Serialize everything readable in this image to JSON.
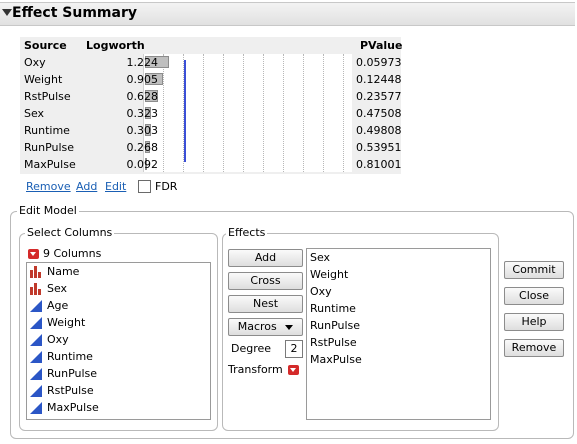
{
  "outline": {
    "title": "Effect Summary"
  },
  "table": {
    "headers": {
      "source": "Source",
      "logworth": "Logworth",
      "pvalue": "PValue"
    },
    "rows": [
      {
        "source": "Oxy",
        "logworth": "1.224",
        "pvalue": "0.05973",
        "value": 1.224
      },
      {
        "source": "Weight",
        "logworth": "0.905",
        "pvalue": "0.12448",
        "value": 0.905
      },
      {
        "source": "RstPulse",
        "logworth": "0.628",
        "pvalue": "0.23577",
        "value": 0.628
      },
      {
        "source": "Sex",
        "logworth": "0.323",
        "pvalue": "0.47508",
        "value": 0.323
      },
      {
        "source": "Runtime",
        "logworth": "0.303",
        "pvalue": "0.49808",
        "value": 0.303
      },
      {
        "source": "RunPulse",
        "logworth": "0.268",
        "pvalue": "0.53951",
        "value": 0.268
      },
      {
        "source": "MaxPulse",
        "logworth": "0.092",
        "pvalue": "0.81001",
        "value": 0.092
      }
    ],
    "reference_logworth": 2.0
  },
  "actions": {
    "remove": "Remove",
    "add": "Add",
    "edit": "Edit",
    "fdr": "FDR",
    "fdr_checked": false
  },
  "edit_model": {
    "title": "Edit Model",
    "select_columns": {
      "title": "Select Columns",
      "count": "9 Columns",
      "columns": [
        {
          "name": "Name",
          "icon": "nominal-icon"
        },
        {
          "name": "Sex",
          "icon": "nominal-icon"
        },
        {
          "name": "Age",
          "icon": "continuous-icon"
        },
        {
          "name": "Weight",
          "icon": "continuous-icon"
        },
        {
          "name": "Oxy",
          "icon": "continuous-icon"
        },
        {
          "name": "Runtime",
          "icon": "continuous-icon"
        },
        {
          "name": "RunPulse",
          "icon": "continuous-icon"
        },
        {
          "name": "RstPulse",
          "icon": "continuous-icon"
        },
        {
          "name": "MaxPulse",
          "icon": "continuous-icon"
        }
      ]
    },
    "effects": {
      "title": "Effects",
      "buttons": {
        "add": "Add",
        "cross": "Cross",
        "nest": "Nest",
        "macros": "Macros"
      },
      "degree_label": "Degree",
      "degree_value": "2",
      "transform_label": "Transform",
      "items": [
        "Sex",
        "Weight",
        "Oxy",
        "Runtime",
        "RunPulse",
        "RstPulse",
        "MaxPulse"
      ]
    },
    "side_buttons": {
      "commit": "Commit",
      "close": "Close",
      "help": "Help",
      "remove": "Remove"
    }
  },
  "colors": {
    "link": "#1a5fb4",
    "bar": "#bfbfbf",
    "ref_line": "#3b4fd6",
    "red_dropdown": "#d42a2a",
    "icon_red": "#c0392b",
    "icon_blue": "#2b56c6"
  }
}
